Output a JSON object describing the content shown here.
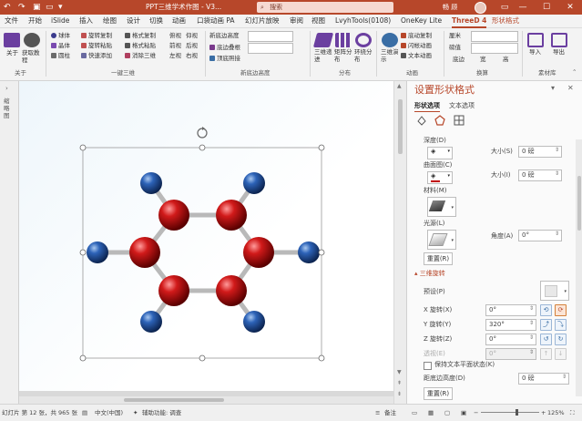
{
  "titlebar": {
    "doc_title": "PPT三维学术作图 - V3...",
    "search_placeholder": "搜索",
    "user_name": "畅 顾",
    "undo_icon": "undo-icon",
    "redo_icon": "redo-icon",
    "colors": {
      "bar": "#b7472a"
    }
  },
  "tabs": [
    "文件",
    "开始",
    "iSlide",
    "插入",
    "绘图",
    "设计",
    "切换",
    "动画",
    "口袋动画 PA",
    "幻灯片放映",
    "审阅",
    "视图",
    "LvyhTools(0108)",
    "OneKey Lite",
    "ThreeD 4",
    "形状格式"
  ],
  "active_tabs": [
    "ThreeD 4",
    "形状格式"
  ],
  "ribbon": {
    "about": {
      "btn1": "关于",
      "btn2": "获取教程",
      "group": "关于"
    },
    "shapes": {
      "items": [
        "球体",
        "晶体",
        "圆柱"
      ]
    },
    "copy": {
      "items": [
        "旋转复制",
        "旋转粘贴",
        "快速添加"
      ]
    },
    "format": {
      "items": [
        "格式复制",
        "格式粘贴",
        "消除三维"
      ]
    },
    "views": {
      "items": [
        "俯视",
        "仰视",
        "前视",
        "后视",
        "左视",
        "右视"
      ]
    },
    "group_3d": "一键三维",
    "bevel": {
      "items": [
        "新底边高度",
        "底边叠根",
        "顶底照接"
      ],
      "group": "新底边高度"
    },
    "distribute": {
      "items": [
        "三维递进",
        "矩阵分布",
        "环绕分布"
      ],
      "group": "分布"
    },
    "anim": {
      "big": "三维演示",
      "items": [
        "底动复制",
        "闪帐动画",
        "文本动画"
      ],
      "group": "动画"
    },
    "convert": {
      "items": [
        "厘米",
        "磅值"
      ],
      "bottom": [
        "底边",
        "宽",
        "高"
      ],
      "group": "换算"
    },
    "library": {
      "items": [
        "导入",
        "导出"
      ],
      "group": "素材库"
    }
  },
  "leftnav": {
    "label": "缩略图"
  },
  "pane": {
    "title": "设置形状格式",
    "tabs": [
      "形状选项",
      "文本选项"
    ],
    "section_labels": {
      "depth": "深度(D)",
      "contour": "曲面图(C)",
      "material": "材料(M)",
      "lighting": "光源(L)",
      "reset1": "重置(R)",
      "rotation_header": "三维旋转",
      "preset": "预设(P)",
      "x_rot": "X 旋转(X)",
      "y_rot": "Y 旋转(Y)",
      "z_rot": "Z 旋转(Z)",
      "perspective": "透视(E)",
      "keep_text_flat": "保持文本平面状态(K)",
      "distance": "距底边高度(D)",
      "reset2": "重置(R)"
    },
    "values": {
      "depth_size_label": "大小(S)",
      "depth_size": "0 磅",
      "contour_size_label": "大小(I)",
      "contour_size": "0 磅",
      "lighting_angle_label": "角度(A)",
      "lighting_angle": "0°",
      "x_rot": "0°",
      "y_rot": "320°",
      "z_rot": "0°",
      "perspective": "0°",
      "distance": "0 磅"
    }
  },
  "statusbar": {
    "slide_info": "幻灯片 第 12 张，共 965 张",
    "language": "中文(中国)",
    "accessibility": "辅助功能: 调查",
    "notes": "备注",
    "zoom": "125%"
  }
}
